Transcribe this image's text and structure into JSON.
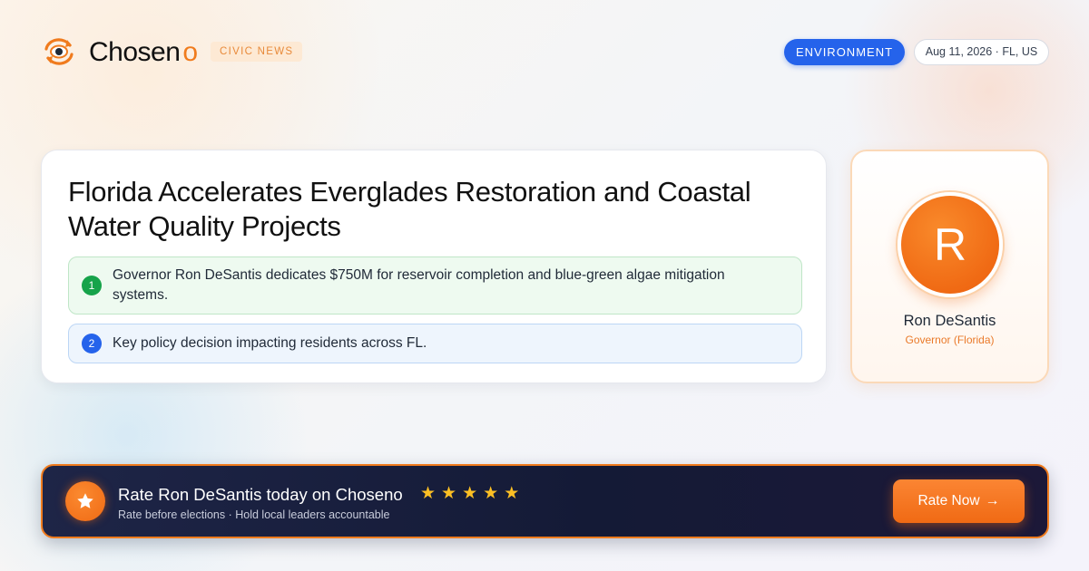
{
  "header": {
    "brand_main": "Chosen",
    "brand_accent": "o",
    "badge": "CIVIC NEWS",
    "category": "ENVIRONMENT",
    "date_location": "Aug 11, 2026 · FL, US",
    "logo_icon": "eye-refresh-icon"
  },
  "article": {
    "headline": "Florida Accelerates Everglades Restoration and Coastal Water Quality Projects",
    "points": [
      {
        "number": "1",
        "text": "Governor Ron DeSantis dedicates $750M for reservoir completion and blue-green algae mitigation systems."
      },
      {
        "number": "2",
        "text": "Key policy decision impacting residents across FL."
      }
    ]
  },
  "profile": {
    "initial": "R",
    "name": "Ron DeSantis",
    "role": "Governor (Florida)"
  },
  "cta": {
    "title": "Rate Ron DeSantis today on Choseno",
    "stars": [
      "★",
      "★",
      "★",
      "★",
      "★"
    ],
    "subtitle": "Rate before elections · Hold local leaders accountable",
    "button_label": "Rate Now",
    "button_arrow": "→"
  },
  "colors": {
    "accent": "#f07b1d",
    "category_blue": "#2563eb",
    "point_green": "#16a34a",
    "star_gold": "#fbbf24",
    "cta_dark": "#141a36"
  }
}
